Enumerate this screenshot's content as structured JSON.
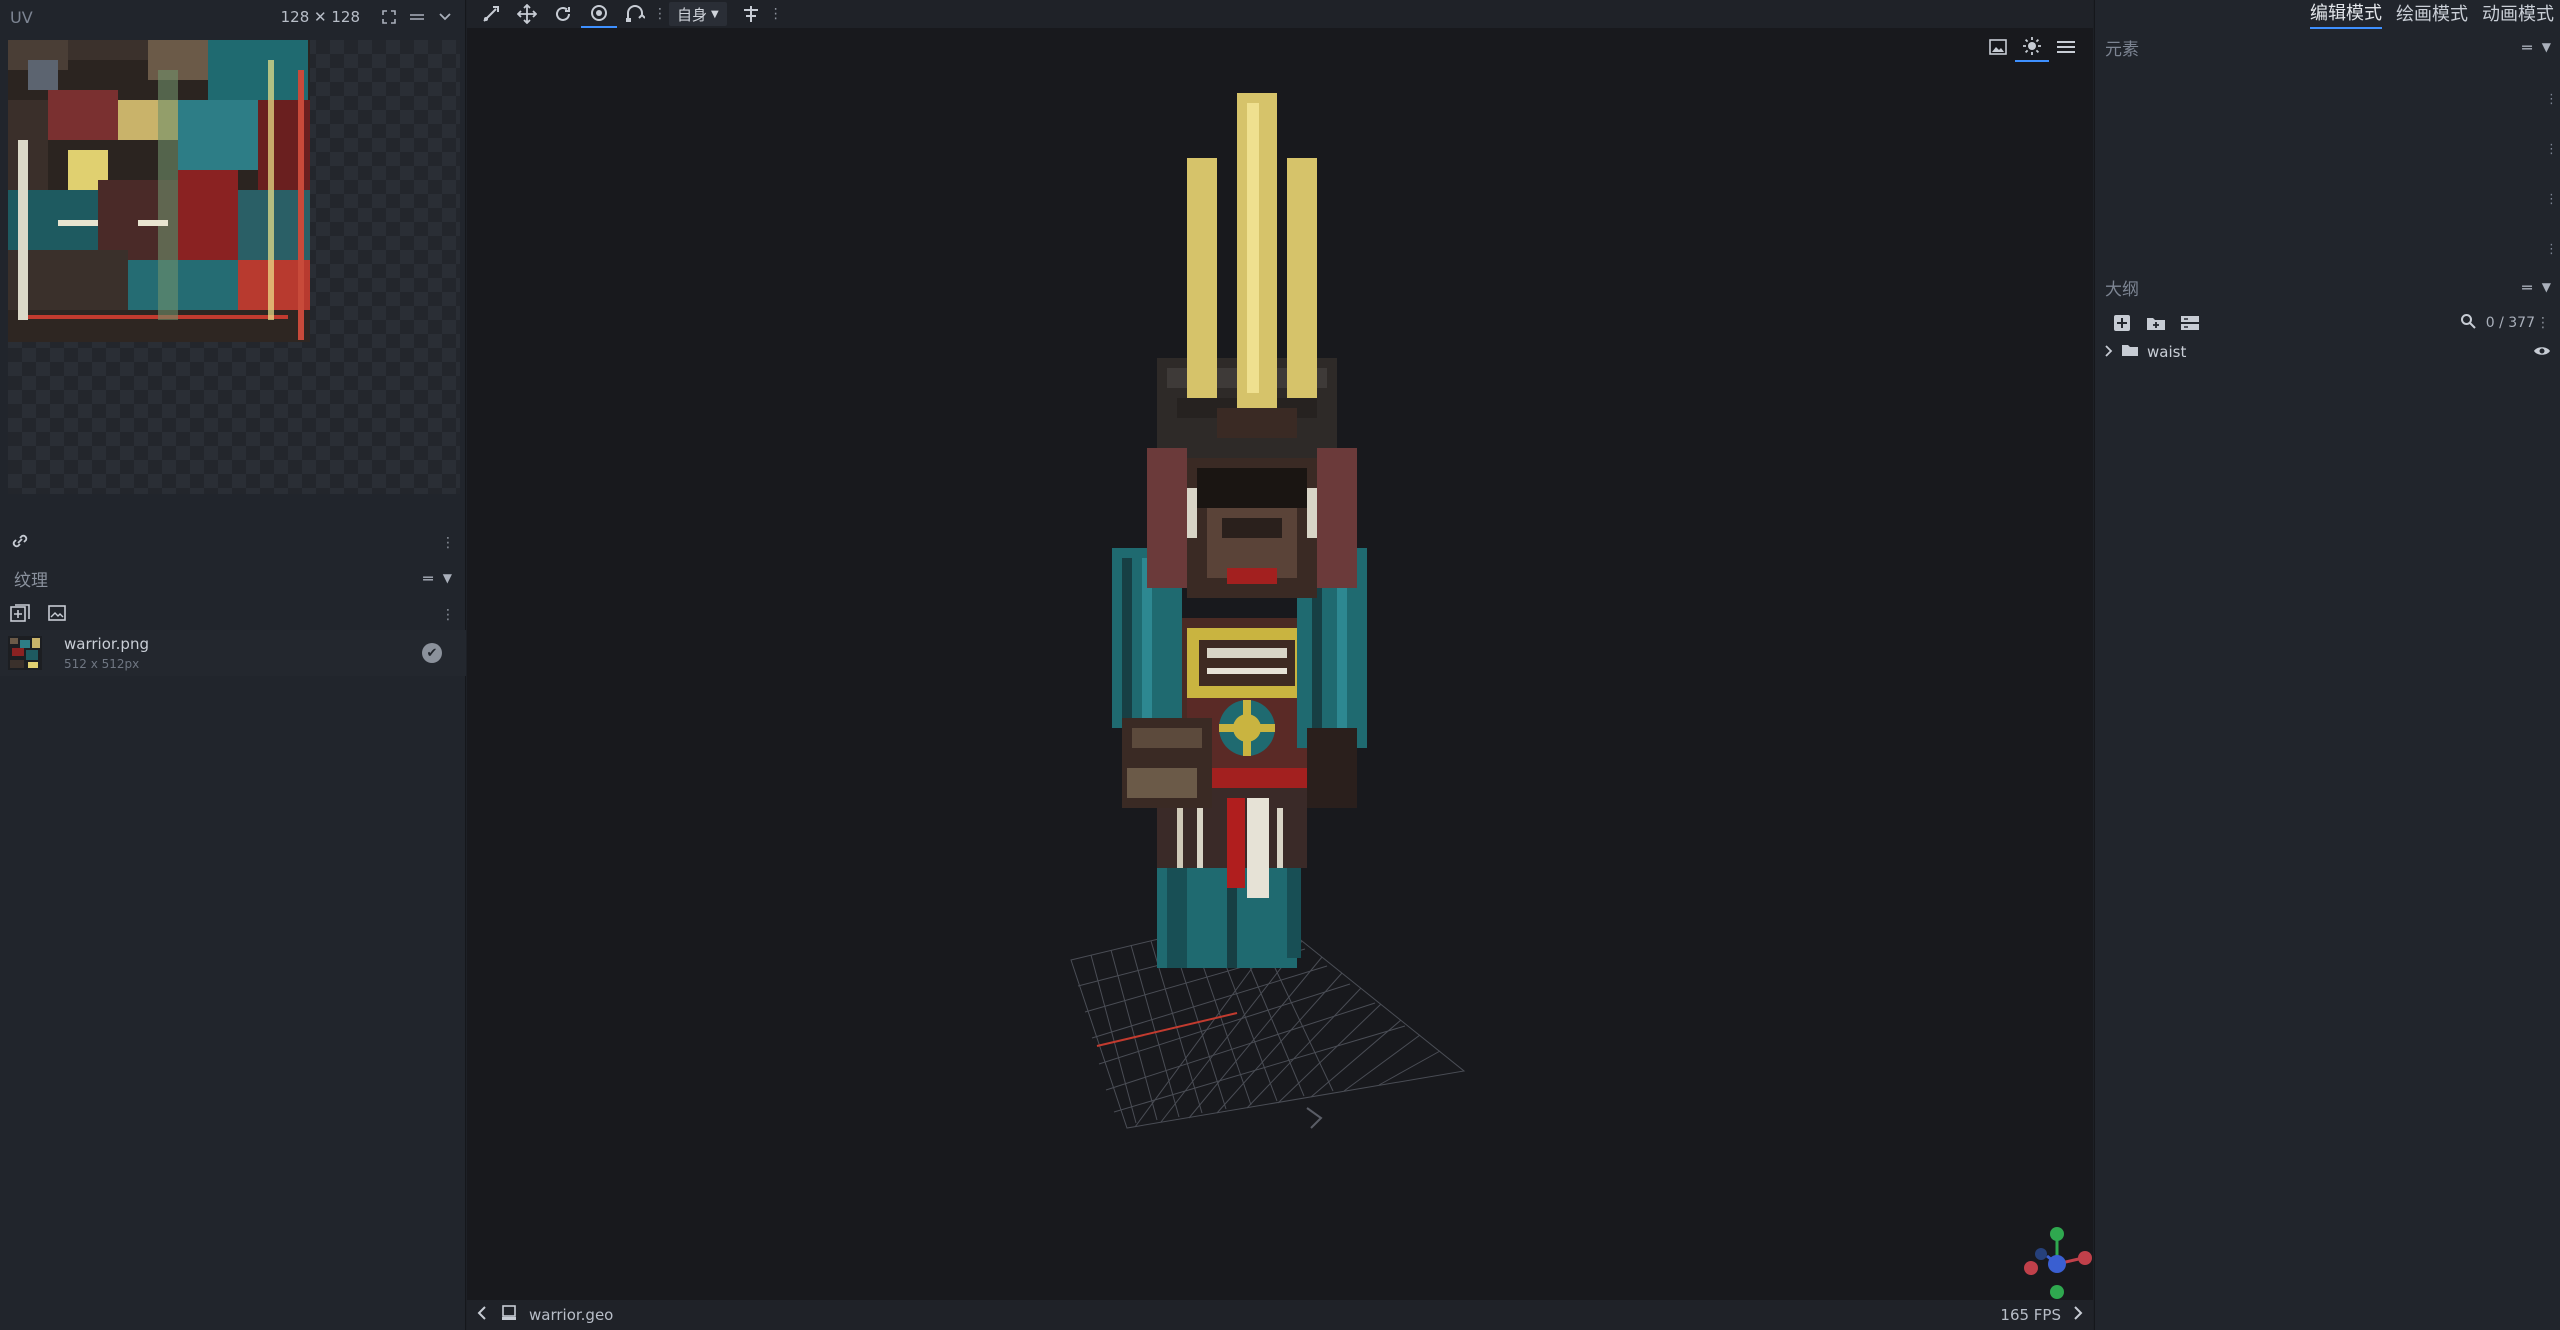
{
  "uv_panel": {
    "title": "UV",
    "size_label": "128 ✕ 128",
    "icons": [
      "fullscreen-icon",
      "menu-icon",
      "chevron-down-icon"
    ]
  },
  "textures_panel": {
    "title": "纹理",
    "items": [
      {
        "name": "warrior.png",
        "size": "512 x 512px"
      }
    ]
  },
  "toolbar": {
    "tools": [
      "move-tool-icon",
      "resize-tool-icon",
      "rotate-tool-icon",
      "pivot-tool-icon",
      "vertex-snap-icon"
    ],
    "space_select": "自身",
    "extra_tool": "mirror-tool-icon"
  },
  "viewport_icons": [
    "image-icon",
    "lighting-icon",
    "menu-icon"
  ],
  "status_bar": {
    "file": "warrior.geo",
    "fps": "165 FPS"
  },
  "modes": [
    {
      "label": "编辑模式",
      "active": true
    },
    {
      "label": "绘画模式",
      "active": false
    },
    {
      "label": "动画模式",
      "active": false
    }
  ],
  "elements_panel": {
    "title": "元素"
  },
  "outliner": {
    "title": "大纲",
    "count": "0 / 377",
    "items": [
      {
        "name": "waist"
      }
    ]
  },
  "colors": {
    "accent": "#3e90ff",
    "panel_bg": "#21252c",
    "viewport_bg": "#18191d"
  }
}
